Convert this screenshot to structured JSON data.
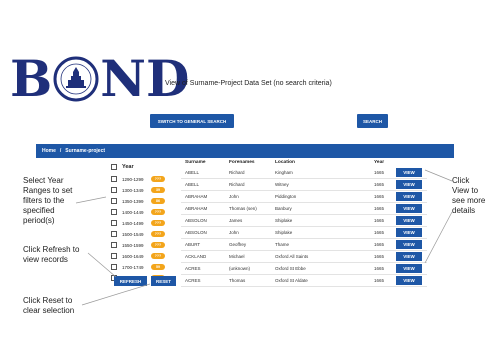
{
  "logo": {
    "letters": [
      "B",
      "N",
      "D"
    ]
  },
  "subtitle": "View of Surname-Project Data Set (no search criteria)",
  "buttons": {
    "switch": "SWITCH TO GENERAL SEARCH",
    "search": "SEARCH",
    "refresh": "REFRESH",
    "reset": "RESET"
  },
  "breadcrumb": {
    "home": "Home",
    "separator": "/",
    "current": "Surname-project"
  },
  "filters": {
    "header": "Year",
    "items": [
      {
        "label": "1290-1299",
        "count": "???"
      },
      {
        "label": "1300-1349",
        "count": "39"
      },
      {
        "label": "1350-1399",
        "count": "86"
      },
      {
        "label": "1400-1449",
        "count": "???"
      },
      {
        "label": "1450-1499",
        "count": "???"
      },
      {
        "label": "1500-1549",
        "count": "???"
      },
      {
        "label": "1550-1599",
        "count": "???"
      },
      {
        "label": "1600-1649",
        "count": "???"
      },
      {
        "label": "1700-1749",
        "count": "59"
      },
      {
        "label": "1750-1799",
        "count": "???"
      }
    ]
  },
  "table": {
    "headers": {
      "surname": "Surname",
      "forenames": "Forenames",
      "location": "Location",
      "year": "Year"
    },
    "view_label": "VIEW",
    "rows": [
      {
        "surname": "ABELL",
        "forenames": "Richard",
        "location": "Kingham",
        "year": "1665"
      },
      {
        "surname": "ABELL",
        "forenames": "Richard",
        "location": "Witney",
        "year": "1665"
      },
      {
        "surname": "ABRAHAM",
        "forenames": "John",
        "location": "Piddington",
        "year": "1665"
      },
      {
        "surname": "ABRAHAM",
        "forenames": "Thomas (sen)",
        "location": "Banbury",
        "year": "1665"
      },
      {
        "surname": "ABSOLON",
        "forenames": "James",
        "location": "Shiplake",
        "year": "1665"
      },
      {
        "surname": "ABSOLON",
        "forenames": "John",
        "location": "Shiplake",
        "year": "1665"
      },
      {
        "surname": "ABURT",
        "forenames": "Geoffrey",
        "location": "Thame",
        "year": "1665"
      },
      {
        "surname": "ACKLAND",
        "forenames": "Michael",
        "location": "Oxford All Saints",
        "year": "1665"
      },
      {
        "surname": "ACRES",
        "forenames": "(unknown)",
        "location": "Oxford St Ebbe",
        "year": "1665"
      },
      {
        "surname": "ACRES",
        "forenames": "Thomas",
        "location": "Oxford St Aldate",
        "year": "1665"
      }
    ]
  },
  "annotations": {
    "left_top": [
      "Select Year",
      "Ranges to set",
      "filters to the",
      "specified",
      "period(s)"
    ],
    "left_mid": [
      "Click Refresh to",
      "view records"
    ],
    "left_bottom": [
      "Click Reset to",
      "clear selection"
    ],
    "right": [
      "Click",
      "View to",
      "see more",
      "details"
    ]
  },
  "colors": {
    "brand_blue": "#1e57a6",
    "logo_navy": "#1f2f7a",
    "badge_orange": "#f3a51b"
  }
}
